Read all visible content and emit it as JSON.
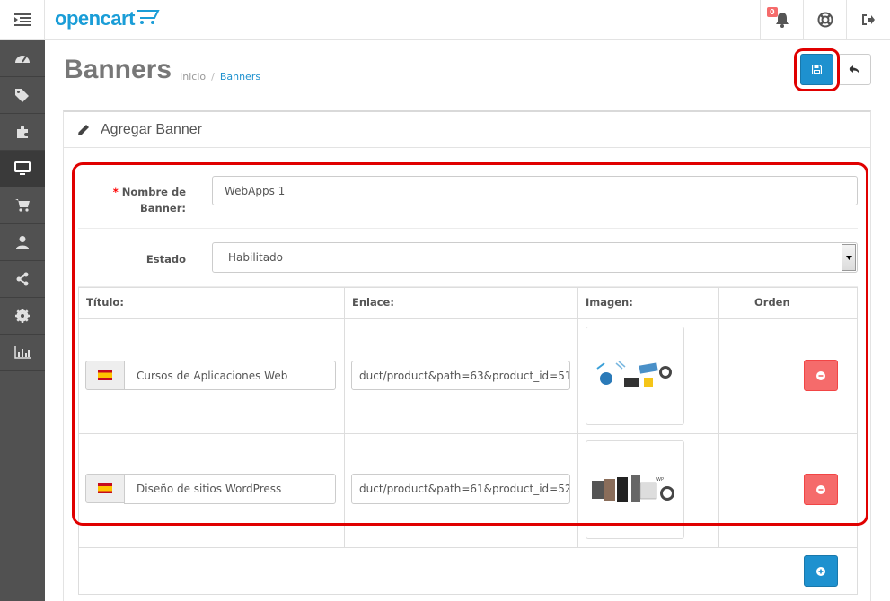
{
  "header": {
    "logo_text": "opencart",
    "notification_count": "0",
    "icons": [
      "menu-toggle-icon",
      "bell-icon",
      "life-ring-icon",
      "logout-icon"
    ]
  },
  "sidebar": {
    "items": [
      {
        "icon": "dashboard-icon"
      },
      {
        "icon": "tags-icon"
      },
      {
        "icon": "puzzle-icon"
      },
      {
        "icon": "desktop-icon",
        "active": true
      },
      {
        "icon": "cart-icon"
      },
      {
        "icon": "user-icon"
      },
      {
        "icon": "share-icon"
      },
      {
        "icon": "cog-icon"
      },
      {
        "icon": "bar-chart-icon"
      }
    ]
  },
  "page": {
    "title": "Banners",
    "breadcrumb": [
      {
        "label": "Inicio"
      },
      {
        "separator": "/"
      },
      {
        "label": "Banners"
      }
    ]
  },
  "panel": {
    "title": "Agregar Banner",
    "form": {
      "name_label_required": "*",
      "name_label_line1": "Nombre de",
      "name_label_line2": "Banner:",
      "name_value": "WebApps 1",
      "status_label": "Estado",
      "status_value": "Habilitado"
    },
    "table": {
      "headers": {
        "title": "Título:",
        "link": "Enlace:",
        "image": "Imagen:",
        "order": "Orden"
      },
      "rows": [
        {
          "title": "Cursos de Aplicaciones Web",
          "link": "duct/product&path=63&product_id=51",
          "order": ""
        },
        {
          "title": "Diseño de sitios WordPress",
          "link": "duct/product&path=61&product_id=52",
          "order": ""
        }
      ]
    }
  },
  "colors": {
    "primary": "#1e91cf",
    "danger": "#f56b6b",
    "sidebar_bg": "#515151",
    "annotation": "#e00000"
  }
}
